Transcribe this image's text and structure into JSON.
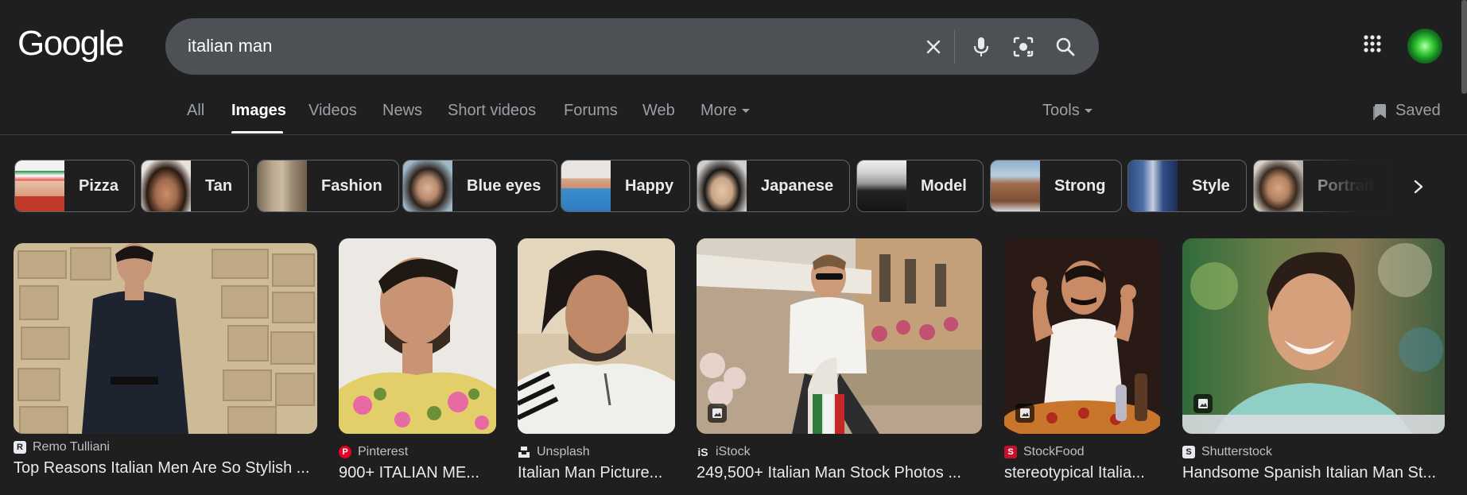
{
  "header": {
    "logo": "Google",
    "search": {
      "value": "italian man"
    },
    "icons": [
      "clear-icon",
      "microphone-icon",
      "camera-lens-icon",
      "search-icon",
      "apps-grid-icon",
      "avatar"
    ]
  },
  "tabs": {
    "items": [
      {
        "label": "All"
      },
      {
        "label": "Images",
        "active": true
      },
      {
        "label": "Videos"
      },
      {
        "label": "News"
      },
      {
        "label": "Short videos"
      },
      {
        "label": "Forums"
      },
      {
        "label": "Web"
      },
      {
        "label": "More"
      }
    ],
    "tools": "Tools",
    "saved": "Saved"
  },
  "chips": [
    {
      "label": "Pizza"
    },
    {
      "label": "Tan"
    },
    {
      "label": "Fashion"
    },
    {
      "label": "Blue eyes"
    },
    {
      "label": "Happy"
    },
    {
      "label": "Japanese"
    },
    {
      "label": "Model"
    },
    {
      "label": "Strong"
    },
    {
      "label": "Style"
    },
    {
      "label": "Portrait"
    }
  ],
  "results": [
    {
      "source": "Remo Tulliani",
      "title": "Top Reasons Italian Men Are So Stylish ..."
    },
    {
      "source": "Pinterest",
      "title": "900+ ITALIAN ME..."
    },
    {
      "source": "Unsplash",
      "title": "Italian Man Picture..."
    },
    {
      "source": "iStock",
      "title": "249,500+ Italian Man Stock Photos ..."
    },
    {
      "source": "StockFood",
      "title": "stereotypical Italia..."
    },
    {
      "source": "Shutterstock",
      "title": "Handsome Spanish Italian Man St..."
    }
  ],
  "colors": {
    "background": "#1f1f1f",
    "searchbox": "#4d5156",
    "text": "#e8eaed",
    "muted": "#9aa0a6",
    "pinterest": "#e60023",
    "stockfood": "#c8102e"
  }
}
